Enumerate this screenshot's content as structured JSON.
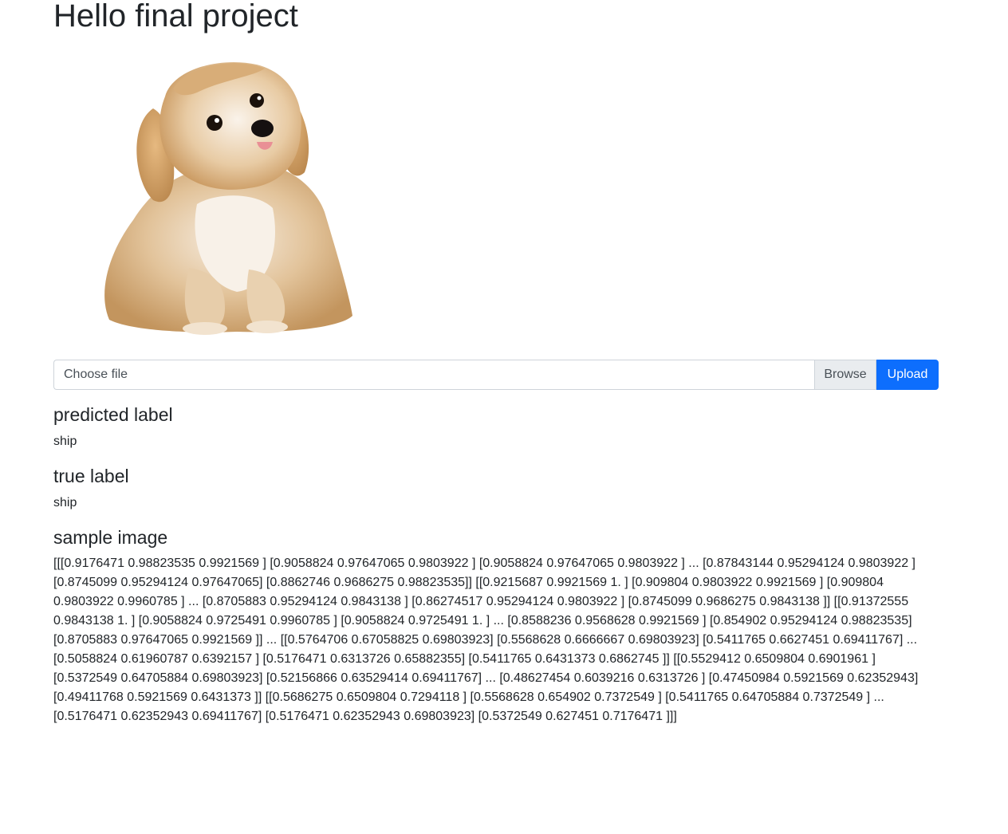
{
  "page": {
    "title": "Hello final project"
  },
  "upload": {
    "file_placeholder": "Choose file",
    "browse_label": "Browse",
    "upload_label": "Upload"
  },
  "results": {
    "predicted_heading": "predicted label",
    "predicted_value": "ship",
    "true_heading": "true label",
    "true_value": "ship",
    "sample_heading": "sample image",
    "sample_array": "[[[0.9176471 0.98823535 0.9921569 ] [0.9058824 0.97647065 0.9803922 ] [0.9058824 0.97647065 0.9803922 ] ... [0.87843144 0.95294124 0.9803922 ] [0.8745099 0.95294124 0.97647065] [0.8862746 0.9686275 0.98823535]] [[0.9215687 0.9921569 1. ] [0.909804 0.9803922 0.9921569 ] [0.909804 0.9803922 0.9960785 ] ... [0.8705883 0.95294124 0.9843138 ] [0.86274517 0.95294124 0.9803922 ] [0.8745099 0.9686275 0.9843138 ]] [[0.91372555 0.9843138 1. ] [0.9058824 0.9725491 0.9960785 ] [0.9058824 0.9725491 1. ] ... [0.8588236 0.9568628 0.9921569 ] [0.854902 0.95294124 0.98823535] [0.8705883 0.97647065 0.9921569 ]] ... [[0.5764706 0.67058825 0.69803923] [0.5568628 0.6666667 0.69803923] [0.5411765 0.6627451 0.69411767] ... [0.5058824 0.61960787 0.6392157 ] [0.5176471 0.6313726 0.65882355] [0.5411765 0.6431373 0.6862745 ]] [[0.5529412 0.6509804 0.6901961 ] [0.5372549 0.64705884 0.69803923] [0.52156866 0.63529414 0.69411767] ... [0.48627454 0.6039216 0.6313726 ] [0.47450984 0.5921569 0.62352943] [0.49411768 0.5921569 0.6431373 ]] [[0.5686275 0.6509804 0.7294118 ] [0.5568628 0.654902 0.7372549 ] [0.5411765 0.64705884 0.7372549 ] ... [0.5176471 0.62352943 0.69411767] [0.5176471 0.62352943 0.69803923] [0.5372549 0.627451 0.7176471 ]]]"
  },
  "colors": {
    "primary": "#0d6efd",
    "browse_bg": "#e9ecef",
    "text": "#212529"
  }
}
